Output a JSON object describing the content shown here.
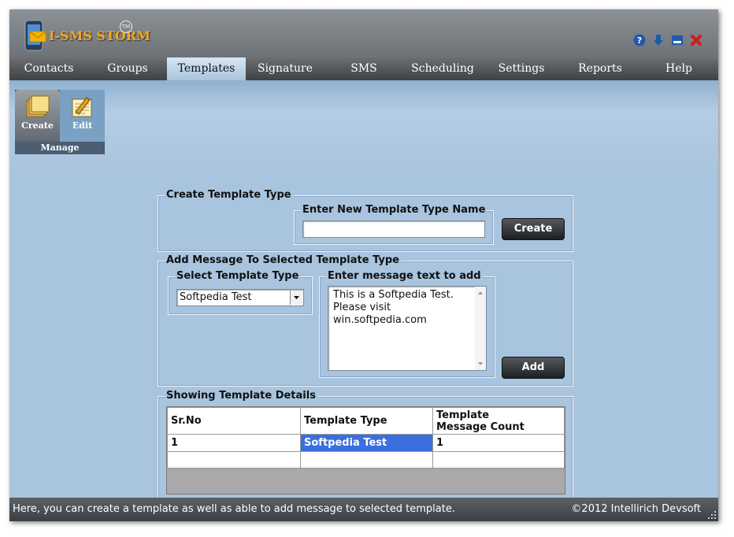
{
  "app": {
    "name": "I-SMS STORM",
    "tm": "TM"
  },
  "window_buttons": [
    {
      "name": "help-icon",
      "color": "#1e5aa8"
    },
    {
      "name": "download-icon",
      "color": "#1e5aa8"
    },
    {
      "name": "minimize-icon",
      "color": "#1e5aa8"
    },
    {
      "name": "close-icon",
      "color": "#d21c1c"
    }
  ],
  "nav": {
    "tabs": [
      "Contacts",
      "Groups",
      "Templates",
      "Signature",
      "SMS",
      "Scheduling",
      "Settings",
      "Reports",
      "Help"
    ],
    "active": "Templates"
  },
  "ribbon": {
    "create_label": "Create",
    "edit_label": "Edit",
    "group_label": "Manage"
  },
  "create_type": {
    "legend": "Create Template Type",
    "inner_legend": "Enter New Template Type Name",
    "name_value": "",
    "button": "Create"
  },
  "add_message": {
    "legend": "Add Message To Selected Template Type",
    "select_legend": "Select Template Type",
    "selected_type": "Softpedia Test",
    "message_legend": "Enter message text to add",
    "message_lines": [
      "This is a Softpedia Test.",
      "Please visit",
      "win.softpedia.com"
    ],
    "button": "Add"
  },
  "details": {
    "legend": "Showing Template Details",
    "headers": [
      "Sr.No",
      "Template Type",
      "Template",
      "Message Count"
    ],
    "rows": [
      [
        "1",
        "Softpedia Test",
        "1"
      ]
    ]
  },
  "status": {
    "message": "Here, you can create a template as well as able to add message to selected template.",
    "copyright": "©2012 Intellirich Devsoft"
  },
  "colors": {
    "accent": "#3a6fe0",
    "background": "#a9c4de"
  }
}
